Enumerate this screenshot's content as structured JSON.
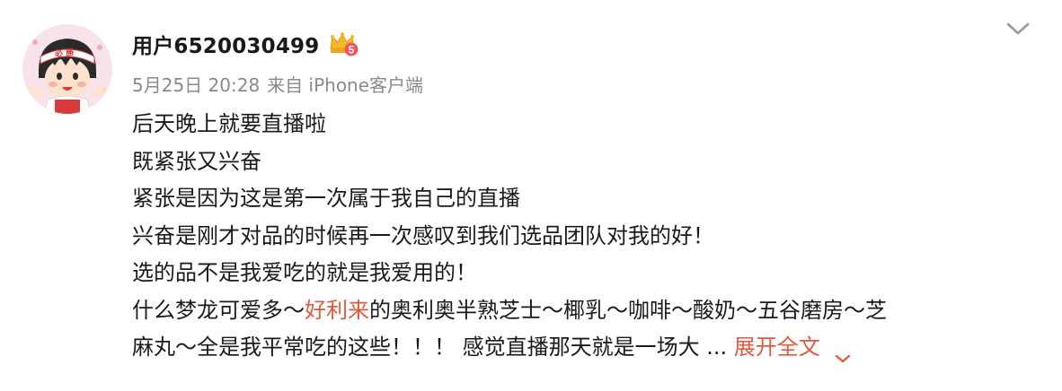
{
  "post": {
    "username": "用户6520030499",
    "date": "5月25日 20:28",
    "source": "来自 iPhone客户端",
    "vip_level": "5",
    "avatar_text": "必 勝",
    "lines": [
      "后天晚上就要直播啦",
      "既紧张又兴奋",
      "紧张是因为这是第一次属于我自己的直播",
      "兴奋是刚才对品的时候再一次感叹到我们选品团队对我的好！",
      "选的品不是我爱吃的就是我爱用的！"
    ],
    "line6": {
      "before": "什么梦龙可爱多～",
      "highlight": "好利来",
      "after": "的奥利奥半熟芝士～椰乳～咖啡～酸奶～五谷磨房～芝"
    },
    "line7": {
      "text": "麻丸～全是我平常吃的这些！！！ 感觉直播那天就是一场大",
      "ellipsis": " ... ",
      "expand_label": "展开全文"
    }
  },
  "colors": {
    "link": "#e0593c",
    "meta": "#8a8a8a",
    "text": "#1a1a1a"
  },
  "icons": {
    "menu": "chevron-down-icon",
    "vip": "crown-vip-icon",
    "expand": "chevron-down-icon"
  }
}
